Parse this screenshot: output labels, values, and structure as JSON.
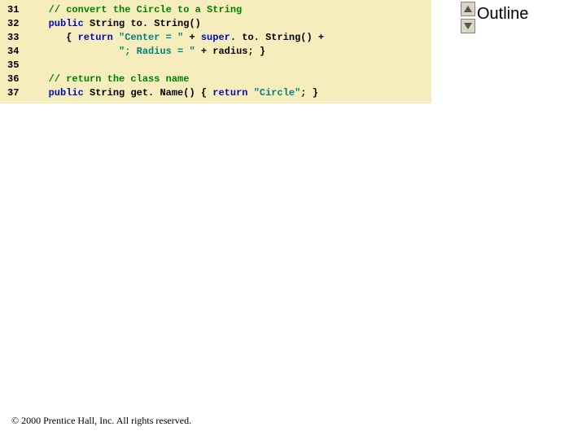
{
  "outline": {
    "title": "Outline"
  },
  "footer": {
    "text": "© 2000 Prentice Hall, Inc. All rights reserved."
  },
  "code": {
    "lines": [
      {
        "n": "31",
        "segs": [
          {
            "cls": "plain",
            "t": "   "
          },
          {
            "cls": "cm",
            "t": "// convert the Circle to a String"
          }
        ]
      },
      {
        "n": "32",
        "segs": [
          {
            "cls": "plain",
            "t": "   "
          },
          {
            "cls": "kw",
            "t": "public"
          },
          {
            "cls": "plain",
            "t": " String to. String()"
          }
        ]
      },
      {
        "n": "33",
        "segs": [
          {
            "cls": "plain",
            "t": "      { "
          },
          {
            "cls": "kw",
            "t": "return"
          },
          {
            "cls": "plain",
            "t": " "
          },
          {
            "cls": "str",
            "t": "\"Center = \""
          },
          {
            "cls": "plain",
            "t": " + "
          },
          {
            "cls": "kw",
            "t": "super"
          },
          {
            "cls": "plain",
            "t": ". to. String() +"
          }
        ]
      },
      {
        "n": "34",
        "segs": [
          {
            "cls": "plain",
            "t": "               "
          },
          {
            "cls": "str",
            "t": "\"; Radius = \""
          },
          {
            "cls": "plain",
            "t": " + radius; }"
          }
        ]
      },
      {
        "n": "35",
        "segs": [
          {
            "cls": "plain",
            "t": ""
          }
        ]
      },
      {
        "n": "36",
        "segs": [
          {
            "cls": "plain",
            "t": "   "
          },
          {
            "cls": "cm",
            "t": "// return the class name"
          }
        ]
      },
      {
        "n": "37",
        "segs": [
          {
            "cls": "plain",
            "t": "   "
          },
          {
            "cls": "kw",
            "t": "public"
          },
          {
            "cls": "plain",
            "t": " String get. Name() { "
          },
          {
            "cls": "kw",
            "t": "return"
          },
          {
            "cls": "plain",
            "t": " "
          },
          {
            "cls": "str",
            "t": "\"Circle\""
          },
          {
            "cls": "plain",
            "t": "; }"
          }
        ]
      }
    ]
  }
}
